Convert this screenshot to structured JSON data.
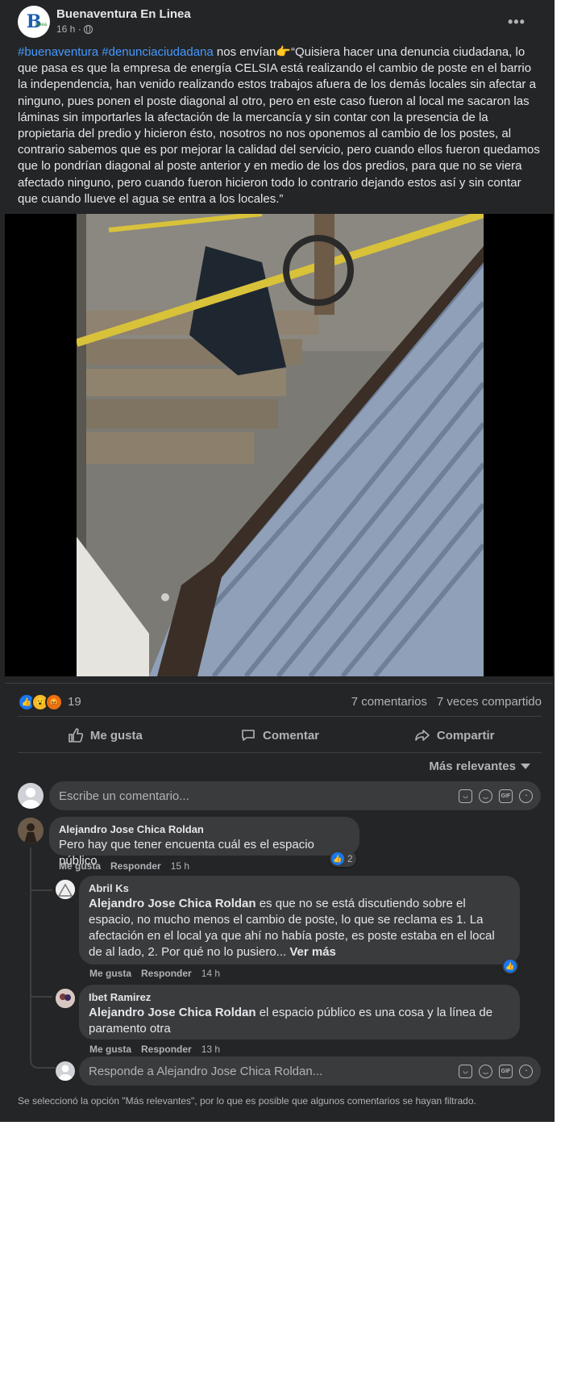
{
  "post": {
    "page_name": "Buenaventura En Linea",
    "avatar_letter": "B",
    "avatar_sub": "Linea",
    "time": "16 h ·",
    "hashtags": [
      "#buenaventura",
      "#denunciaciudadana"
    ],
    "intro": " nos envían👉",
    "body": "“Quisiera hacer una denuncia ciudadana, lo que pasa es que la empresa de energía CELSIA está realizando el cambio de poste en el barrio la independencia, han venido realizando estos trabajos afuera de los demás locales sin afectar a ninguno, pues ponen el poste diagonal al otro, pero en este caso fueron al local me sacaron las láminas sin importarles la afectación de la mercancía y sin contar con la presencia de la propietaria del predio y hicieron ésto, nosotros no nos oponemos al cambio de los postes, al contrario sabemos que es por mejorar la calidad del servicio, pero cuando ellos fueron quedamos que lo pondrían diagonal al poste anterior y en medio de los dos predios, para que no se viera afectado ninguno, pero cuando fueron hicieron todo lo contrario dejando estos así y sin contar que cuando llueve el agua se entra a los locales.”",
    "more_icon": "more-horizontal-icon"
  },
  "stats": {
    "reaction_count": "19",
    "comments": "7 comentarios",
    "shares": "7 veces compartido"
  },
  "actions": {
    "like": "Me gusta",
    "comment": "Comentar",
    "share": "Compartir"
  },
  "sort_label": "Más relevantes",
  "composer": {
    "placeholder": "Escribe un comentario...",
    "icons": [
      "sticker-icon",
      "emoji-icon",
      "gif-icon",
      "sticker-2-icon"
    ],
    "gif": "GIF"
  },
  "comments": [
    {
      "author": "Alejandro Jose Chica Roldan",
      "text": "Pero hay que tener encuenta cuál es el espacio público",
      "like_count": "2",
      "like": "Me gusta",
      "reply": "Responder",
      "time": "15 h"
    },
    {
      "author": "Abril Ks",
      "tag": "Alejandro Jose Chica Roldan",
      "text": " es que no se está discutiendo sobre el espacio, no mucho menos el cambio de poste, lo que se reclama es 1. La afectación en el local ya que ahí no había poste, es poste estaba en el local de al lado, 2. Por qué no lo pusiero...",
      "see_more": " Ver más",
      "like": "Me gusta",
      "reply": "Responder",
      "time": "14 h"
    },
    {
      "author": "Ibet Ramirez",
      "tag": "Alejandro Jose Chica Roldan",
      "text": " el espacio público es una cosa y la línea de paramento otra",
      "like": "Me gusta",
      "reply": "Responder",
      "time": "13 h"
    }
  ],
  "reply_composer": {
    "placeholder": "Responde a Alejandro Jose Chica Roldan..."
  },
  "footnote": "Se seleccionó la opción \"Más relevantes\", por lo que es posible que algunos comentarios se hayan filtrado.",
  "colors": {
    "card": "#242526",
    "bubble": "#3a3b3c",
    "text": "#e4e6eb",
    "secondary": "#b0b3b8",
    "link": "#4599ff",
    "like_blue": "#1877f2"
  }
}
